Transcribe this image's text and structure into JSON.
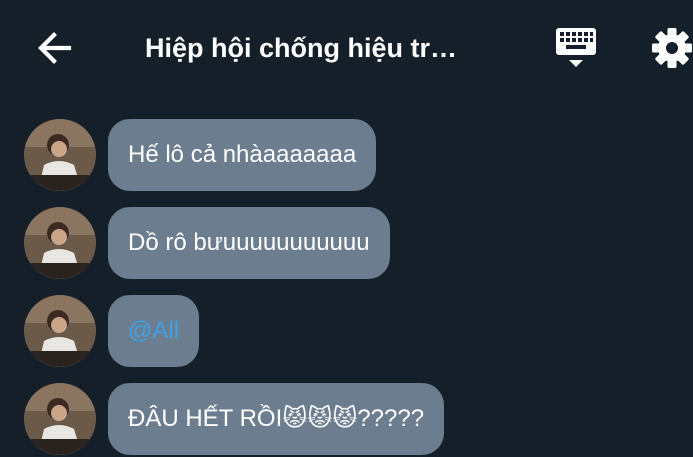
{
  "header": {
    "title": "Hiệp hội chống hiệu tr…",
    "back_icon": "arrow-left-icon",
    "keyboard_icon": "keyboard-icon",
    "settings_icon": "gear-icon"
  },
  "messages": [
    {
      "text": "Hế lô cả nhàaaaaaaa"
    },
    {
      "text": "Dồ rô bưuuuuuuuuuuu"
    },
    {
      "text": "@All"
    },
    {
      "text": "ĐÂU HẾT RỒI😾😾😾?????"
    }
  ],
  "colors": {
    "background": "#151f2a",
    "bubble": "#6b7d8e",
    "mention": "#3fa2e3",
    "text": "#ffffff"
  }
}
